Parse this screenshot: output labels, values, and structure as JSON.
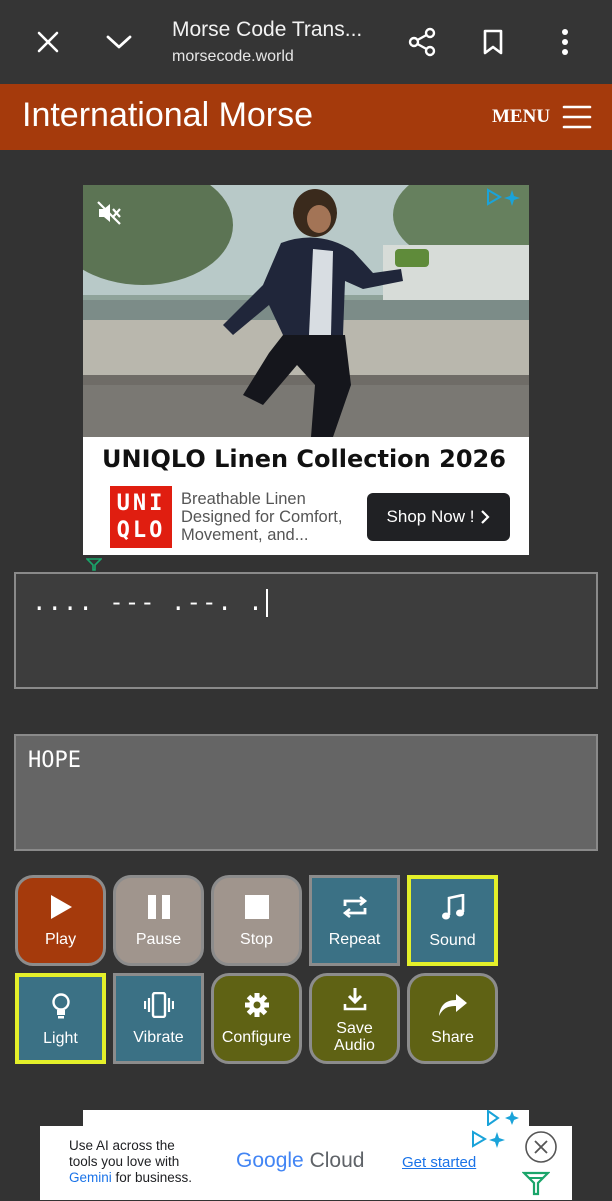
{
  "browser": {
    "title": "Morse Code Trans...",
    "url": "morsecode.world",
    "icons": [
      "close-icon",
      "chevron-down-icon",
      "share-icon",
      "bookmark-icon",
      "more-vert-icon"
    ]
  },
  "site": {
    "brand": "International Morse",
    "menu_label": "MENU"
  },
  "ad_top": {
    "title": "UNIQLO Linen Collection 2026",
    "logo_top": "UNI",
    "logo_bottom": "QLO",
    "description": "Breathable Linen Designed for Comfort, Movement, and...",
    "cta": "Shop Now !"
  },
  "translator": {
    "morse_value": ".... --- .--. .",
    "text_value": "HOPE"
  },
  "controls": {
    "play": "Play",
    "pause": "Pause",
    "stop": "Stop",
    "repeat": "Repeat",
    "sound": "Sound",
    "light": "Light",
    "vibrate": "Vibrate",
    "configure": "Configure",
    "save_audio_1": "Save",
    "save_audio_2": "Audio",
    "share": "Share"
  },
  "colors": {
    "site_bar": "#a53a0c",
    "play": "#a53a0c",
    "media": "#a0958d",
    "teal": "#3b7185",
    "olive": "#5f6214",
    "highlight": "#e4f02a"
  },
  "ad_bottom": {
    "line1": "Use AI across the",
    "line2": "tools you love with",
    "gemini": "Gemini",
    "line3_rest": " for business.",
    "brand_google": "Google",
    "brand_cloud": "Cloud",
    "cta": "Get started"
  }
}
